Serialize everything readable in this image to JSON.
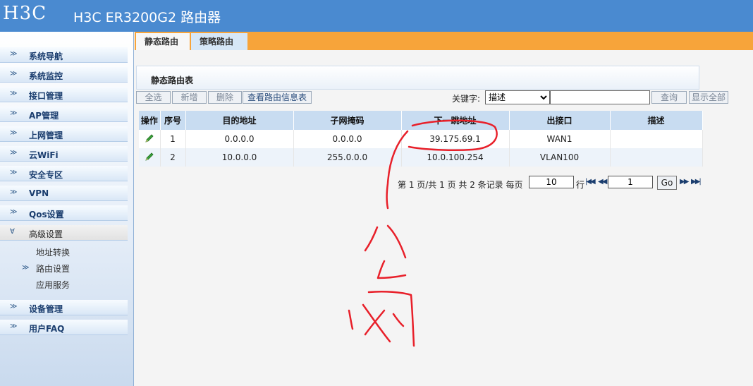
{
  "header": {
    "logo": "H3C",
    "title": "H3C ER3200G2 路由器"
  },
  "sidebar": {
    "items": [
      {
        "label": "系统导航"
      },
      {
        "label": "系统监控"
      },
      {
        "label": "接口管理"
      },
      {
        "label": "AP管理"
      },
      {
        "label": "上网管理"
      },
      {
        "label": "云WiFi"
      },
      {
        "label": "安全专区"
      },
      {
        "label": "VPN"
      },
      {
        "label": "Qos设置"
      },
      {
        "label": "高级设置"
      },
      {
        "label": "设备管理"
      },
      {
        "label": "用户FAQ"
      }
    ],
    "subitems": [
      {
        "label": "地址转换"
      },
      {
        "label": "路由设置"
      },
      {
        "label": "应用服务"
      }
    ]
  },
  "tabs": [
    {
      "label": "静态路由"
    },
    {
      "label": "策略路由"
    }
  ],
  "panel": {
    "title": "静态路由表"
  },
  "toolbar": {
    "select_all": "全选",
    "add": "新增",
    "delete": "删除",
    "view_route_info": "查看路由信息表",
    "keyword_label": "关键字:",
    "keyword_selected": "描述",
    "keyword_input_value": "",
    "search": "查询",
    "show_all": "显示全部"
  },
  "table": {
    "headers": [
      "操作",
      "序号",
      "目的地址",
      "子网掩码",
      "下一跳地址",
      "出接口",
      "描述"
    ],
    "rows": [
      {
        "index": "1",
        "dest": "0.0.0.0",
        "mask": "0.0.0.0",
        "next_hop": "39.175.69.1",
        "iface": "WAN1",
        "desc": ""
      },
      {
        "index": "2",
        "dest": "10.0.0.0",
        "mask": "255.0.0.0",
        "next_hop": "10.0.100.254",
        "iface": "VLAN100",
        "desc": ""
      }
    ]
  },
  "pagination": {
    "summary": "第 1 页/共 1 页 共 2 条记录 每页",
    "per_page": "10",
    "rows_unit": "行",
    "current_page": "1",
    "go": "Go"
  },
  "annotation": {
    "text": "公网"
  },
  "colors": {
    "header_bg": "#4a8ad0",
    "tab_bar": "#f7a43a",
    "table_header": "#c8dcf1",
    "annotation_red": "#e8202a"
  }
}
